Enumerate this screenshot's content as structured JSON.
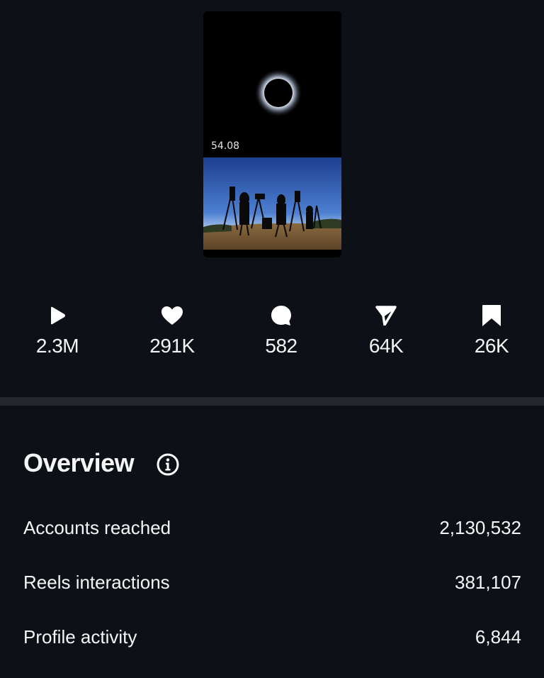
{
  "reel": {
    "duration": "54.08"
  },
  "stats": [
    {
      "icon": "play-icon",
      "value": "2.3M"
    },
    {
      "icon": "heart-icon",
      "value": "291K"
    },
    {
      "icon": "comment-icon",
      "value": "582"
    },
    {
      "icon": "share-icon",
      "value": "64K"
    },
    {
      "icon": "bookmark-icon",
      "value": "26K"
    }
  ],
  "overview": {
    "title": "Overview",
    "rows": [
      {
        "label": "Accounts reached",
        "value": "2,130,532"
      },
      {
        "label": "Reels interactions",
        "value": "381,107"
      },
      {
        "label": "Profile activity",
        "value": "6,844"
      }
    ]
  }
}
